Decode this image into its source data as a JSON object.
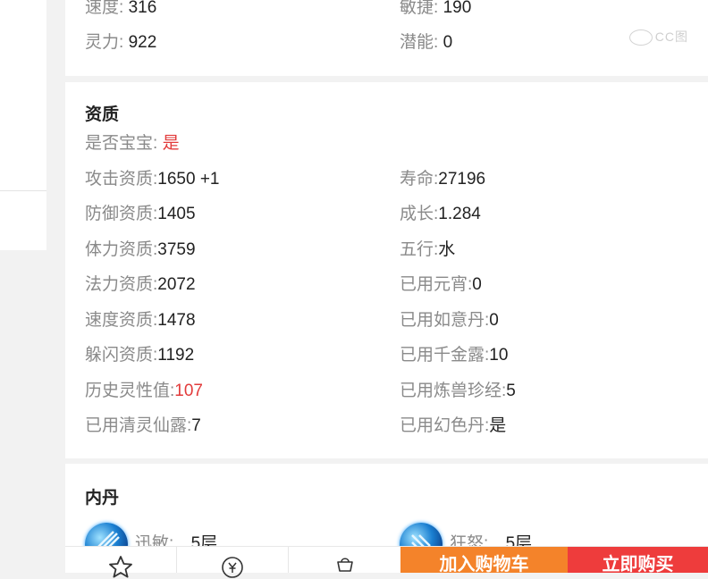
{
  "top_card": {
    "stats": [
      {
        "label": "速度:",
        "value": "316"
      },
      {
        "label": "敏捷:",
        "value": "190"
      },
      {
        "label": "灵力:",
        "value": "922"
      },
      {
        "label": "潜能:",
        "value": "0"
      }
    ],
    "watermark": "CC图"
  },
  "aptitude": {
    "title": "资质",
    "is_baby": {
      "label": "是否宝宝:",
      "value": "是"
    },
    "rows": [
      {
        "label": "攻击资质:",
        "value": "1650 +1"
      },
      {
        "label": "寿命:",
        "value": "27196"
      },
      {
        "label": "防御资质:",
        "value": "1405"
      },
      {
        "label": "成长:",
        "value": "1.284"
      },
      {
        "label": "体力资质:",
        "value": "3759"
      },
      {
        "label": "五行:",
        "value": "水"
      },
      {
        "label": "法力资质:",
        "value": "2072"
      },
      {
        "label": "已用元宵:",
        "value": "0"
      },
      {
        "label": "速度资质:",
        "value": "1478"
      },
      {
        "label": "已用如意丹:",
        "value": "0"
      },
      {
        "label": "躲闪资质:",
        "value": "1192"
      },
      {
        "label": "已用千金露:",
        "value": "10"
      },
      {
        "label": "历史灵性值:",
        "value": "107"
      },
      {
        "label": "已用炼兽珍经:",
        "value": "5"
      },
      {
        "label": "已用清灵仙露:",
        "value": "7"
      },
      {
        "label": "已用幻色丹:",
        "value": "是"
      }
    ]
  },
  "neidan": {
    "title": "内丹",
    "items": [
      {
        "name": "迅敏:",
        "level": "5层",
        "icon": "gem-icon"
      },
      {
        "name": "狂怒:",
        "level": "5层",
        "icon": "gem-icon"
      }
    ]
  },
  "bottom_bar": {
    "favorite_icon": "star-icon",
    "price_icon": "yen-icon",
    "cart_icon": "cart-icon",
    "add_to_cart": "加入购物车",
    "buy_now": "立即购买"
  },
  "colors": {
    "accent_red": "#e23b3b",
    "cart_orange": "#f4832a",
    "buy_red": "#ee3c3c"
  }
}
